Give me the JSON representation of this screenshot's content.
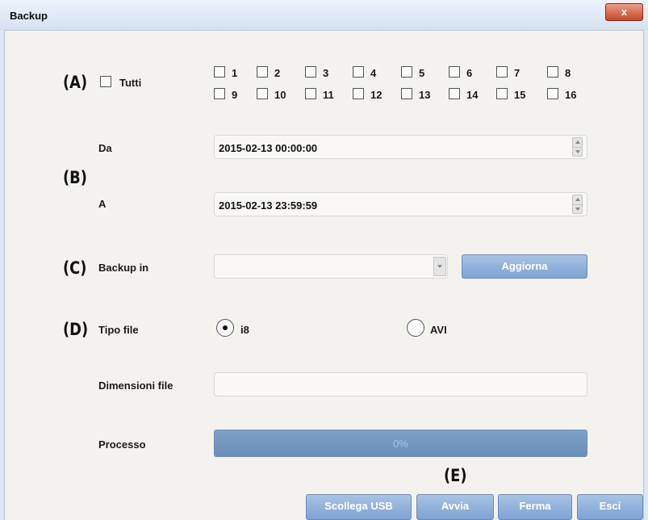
{
  "window": {
    "title": "Backup",
    "close_label": "x"
  },
  "markers": {
    "a": "(A)",
    "b": "(B)",
    "c": "(C)",
    "d": "(D)",
    "e": "(E)"
  },
  "channels": {
    "all_label": "Tutti",
    "all_checked": false,
    "items": [
      {
        "label": "1",
        "checked": false
      },
      {
        "label": "2",
        "checked": false
      },
      {
        "label": "3",
        "checked": false
      },
      {
        "label": "4",
        "checked": false
      },
      {
        "label": "5",
        "checked": false
      },
      {
        "label": "6",
        "checked": false
      },
      {
        "label": "7",
        "checked": false
      },
      {
        "label": "8",
        "checked": false
      },
      {
        "label": "9",
        "checked": false
      },
      {
        "label": "10",
        "checked": false
      },
      {
        "label": "11",
        "checked": false
      },
      {
        "label": "12",
        "checked": false
      },
      {
        "label": "13",
        "checked": false
      },
      {
        "label": "14",
        "checked": false
      },
      {
        "label": "15",
        "checked": false
      },
      {
        "label": "16",
        "checked": false
      }
    ]
  },
  "time_range": {
    "from_label": "Da",
    "from_value": "2015-02-13 00:00:00",
    "to_label": "A",
    "to_value": "2015-02-13 23:59:59"
  },
  "backup_in": {
    "label": "Backup in",
    "value": "",
    "refresh_label": "Aggiorna"
  },
  "file_type": {
    "label": "Tipo file",
    "options": [
      "i8",
      "AVI"
    ],
    "selected": "i8"
  },
  "file_size": {
    "label": "Dimensioni file",
    "value": ""
  },
  "process": {
    "label": "Processo",
    "text": "0%",
    "progress": 0
  },
  "buttons": {
    "eject_usb": "Scollega USB",
    "start": "Avvia",
    "stop": "Ferma",
    "exit": "Esci"
  },
  "colors": {
    "accent": "#7ea2d2",
    "progress": "#6a8fb8",
    "close": "#c8452a"
  }
}
